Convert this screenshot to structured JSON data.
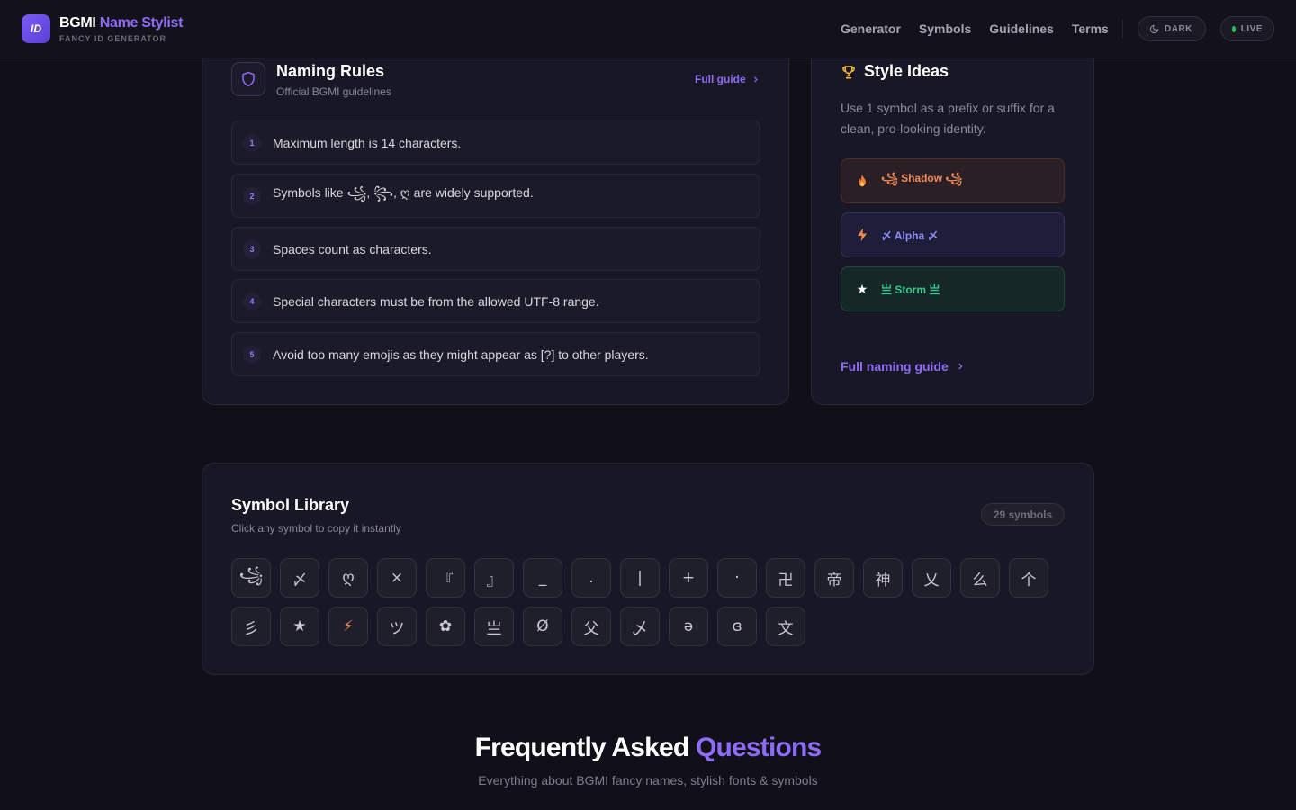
{
  "header": {
    "logo_text": "ID",
    "brand_part1": "BGMI",
    "brand_part2": "Name Stylist",
    "brand_sub": "FANCY ID GENERATOR",
    "nav": [
      "Generator",
      "Symbols",
      "Guidelines",
      "Terms"
    ],
    "theme_label": "DARK",
    "live_label": "LIVE"
  },
  "rules": {
    "title": "Naming Rules",
    "subtitle": "Official BGMI guidelines",
    "full_guide": "Full guide",
    "items": [
      {
        "num": "1",
        "text": "Maximum length is 14 characters."
      },
      {
        "num": "2",
        "text": "Symbols like ꧁, ꧂, ღ are widely supported."
      },
      {
        "num": "3",
        "text": "Spaces count as characters."
      },
      {
        "num": "4",
        "text": "Special characters must be from the allowed UTF-8 range."
      },
      {
        "num": "5",
        "text": "Avoid too many emojis as they might appear as [?] to other players."
      }
    ]
  },
  "ideas": {
    "title": "Style Ideas",
    "desc": "Use 1 symbol as a prefix or suffix for a clean, pro-looking identity.",
    "items": [
      {
        "icon": "fire-icon",
        "label": "꧁ Shadow ꧁"
      },
      {
        "icon": "lightning-icon",
        "label": "〆 Alpha 〆"
      },
      {
        "icon": "star-icon",
        "label": "亗 Storm 亗"
      }
    ],
    "guide_link": "Full naming guide"
  },
  "symbols": {
    "title": "Symbol Library",
    "subtitle": "Click any symbol to copy it instantly",
    "count": "29 symbols",
    "list": [
      "꧁",
      "〆",
      "ღ",
      "×",
      "『",
      "』",
      "_",
      ".",
      "|",
      "+",
      "·",
      "卍",
      "帝",
      "神",
      "乂",
      "么",
      "个",
      "彡",
      "★",
      "⚡",
      "ツ",
      "✿",
      "亗",
      "Ø",
      "父",
      "乄",
      "ə",
      "ɞ",
      "文"
    ]
  },
  "faq": {
    "title_white": "Frequently Asked",
    "title_purple": "Questions",
    "subtitle": "Everything about BGMI fancy names, stylish fonts & symbols"
  },
  "colors": {
    "accent": "#8e6cf7",
    "background": "#111019",
    "live": "#22c55e"
  }
}
